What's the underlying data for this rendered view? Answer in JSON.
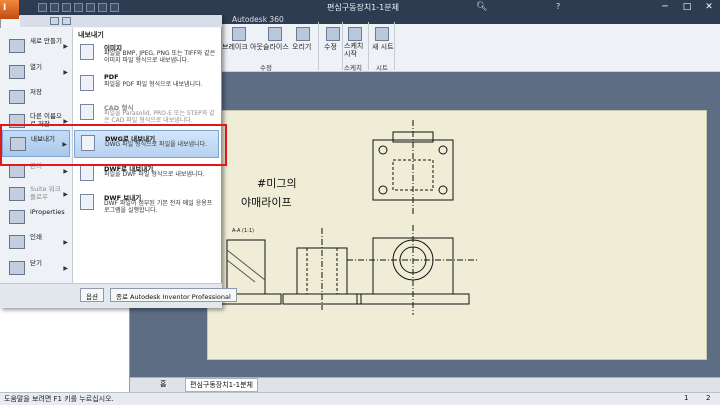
{
  "window": {
    "title": "편심구동장치1-1분체",
    "app_logo_text": "I",
    "minimize": "─",
    "maximize": "□",
    "close": "✕"
  },
  "titlebar": {
    "search_icon": "search-icon",
    "help": "?"
  },
  "ribbon": {
    "tab": "Autodesk 360",
    "buttons": {
      "raster": "브레이크 아웃",
      "slice": "슬라이스",
      "crop": "오리기",
      "modify": "수정",
      "sketch": "스케치 시작",
      "new_sheet": "새 시트"
    },
    "groups": {
      "modify": "수정",
      "sketch": "스케치",
      "sheet": "시트"
    }
  },
  "app_menu": {
    "items": [
      {
        "label": "새로 만들기"
      },
      {
        "label": "열기"
      },
      {
        "label": "저장"
      },
      {
        "label": "다른 이름으로 저장"
      },
      {
        "label": "내보내기"
      },
      {
        "label": "관리"
      },
      {
        "label": "Suite 워크플로우"
      },
      {
        "label": "iProperties"
      },
      {
        "label": "인쇄"
      },
      {
        "label": "닫기"
      }
    ],
    "submenu_title": "내보내기",
    "submenu": [
      {
        "title": "이미지",
        "desc": "파일을 BMP, JPEG, PNG 또는 TIFF와 같은 이미지 파일 형식으로 내보냅니다."
      },
      {
        "title": "PDF",
        "desc": "파일을 PDF 파일 형식으로 내보냅니다."
      },
      {
        "title": "CAD 형식",
        "desc": "파일을 Parasolid, PRO-E 또는 STEP과 같은 CAD 파일 형식으로 내보냅니다."
      },
      {
        "title": "DWG로 내보내기",
        "desc": "DWG 파일 형식으로 파일을 내보냅니다."
      },
      {
        "title": "DWF로 내보내기",
        "desc": "파일을 DWF 파일 형식으로 내보냅니다."
      },
      {
        "title": "DWF 보내기",
        "desc": "DWF 파일이 첨부된 기본 전자 메일 응용프로그램을 실행합니다."
      }
    ],
    "options_button": "옵션",
    "exit_button": "종료 Autodesk Inventor Professional"
  },
  "drawing": {
    "handwriting_line1": "#미그의",
    "handwriting_line2": "야매라이프",
    "section_label": "A-A (1:1)"
  },
  "doc_tabs": {
    "home": "홈",
    "active": "편심구동장치1-1분체"
  },
  "status": {
    "text": "도움말을 보려면 F1 키를 누르십시오.",
    "n1": "1",
    "n2": "2"
  }
}
